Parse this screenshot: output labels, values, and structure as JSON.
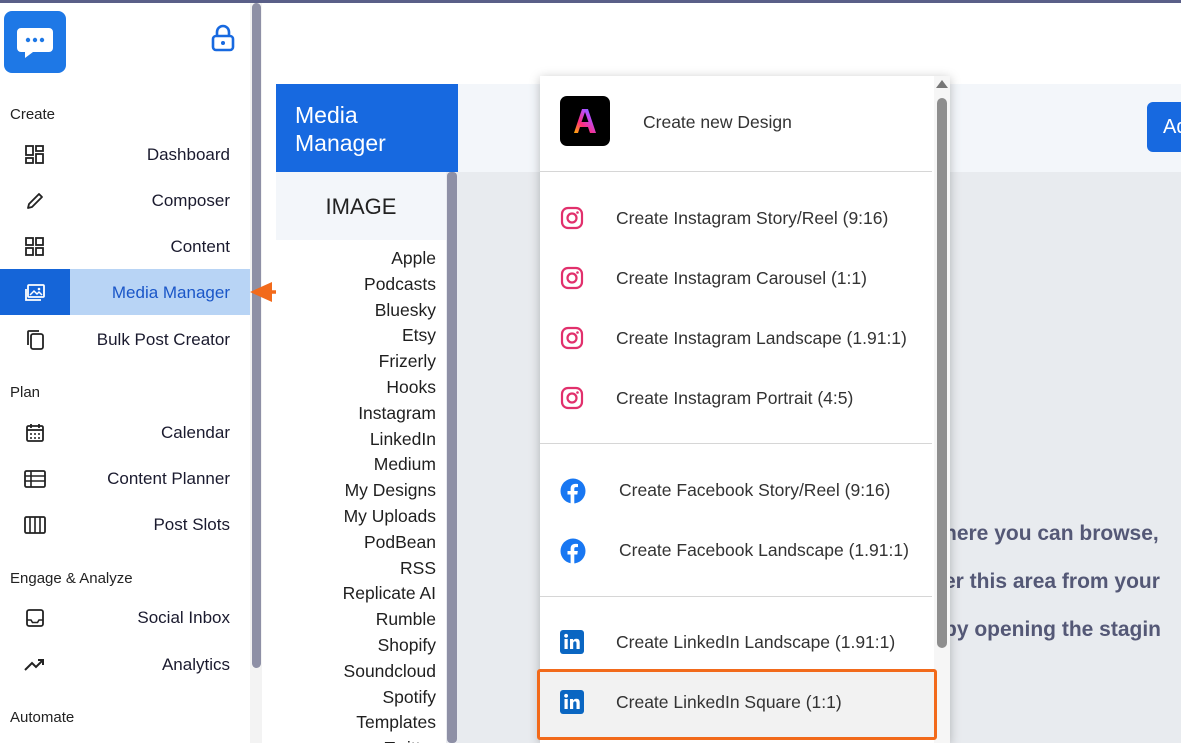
{
  "colors": {
    "accent": "#1769e0",
    "active_bg": "#b8d4f5",
    "highlight": "#f26a1b",
    "instagram": "#e1306c",
    "facebook": "#1877f2",
    "linkedin": "#0a66c2"
  },
  "sidebar": {
    "logo_icon": "chat-bubble-icon",
    "lock_icon": "lock-icon",
    "sections": {
      "create": "Create",
      "plan": "Plan",
      "engage": "Engage & Analyze",
      "automate": "Automate"
    },
    "items": [
      {
        "label": "Dashboard",
        "icon": "dashboard-icon"
      },
      {
        "label": "Composer",
        "icon": "pencil-icon"
      },
      {
        "label": "Content",
        "icon": "grid-icon"
      },
      {
        "label": "Media Manager",
        "icon": "image-gallery-icon",
        "active": true
      },
      {
        "label": "Bulk Post Creator",
        "icon": "copy-stack-icon"
      },
      {
        "label": "Calendar",
        "icon": "calendar-icon"
      },
      {
        "label": "Content Planner",
        "icon": "table-icon"
      },
      {
        "label": "Post Slots",
        "icon": "slots-icon"
      },
      {
        "label": "Social Inbox",
        "icon": "inbox-icon"
      },
      {
        "label": "Analytics",
        "icon": "trend-icon"
      }
    ]
  },
  "media_manager": {
    "title": "Media\nManager",
    "add_button": "Ad",
    "tab": "IMAGE",
    "sources": [
      "Apple",
      "Podcasts",
      "Bluesky",
      "Etsy",
      "Frizerly",
      "Hooks",
      "Instagram",
      "LinkedIn",
      "Medium",
      "My Designs",
      "My Uploads",
      "PodBean",
      "RSS",
      "Replicate AI",
      "Rumble",
      "Shopify",
      "Soundcloud",
      "Spotify",
      "Templates",
      "Twitter"
    ],
    "body_lines": [
      "here you can browse,",
      "er this area from your",
      "by opening the stagin"
    ]
  },
  "dropdown": {
    "items": [
      {
        "label": "Create new Design",
        "icon": "adobe-express-icon"
      },
      {
        "label": "Create Instagram Story/Reel (9:16)",
        "icon": "instagram-icon"
      },
      {
        "label": "Create Instagram Carousel (1:1)",
        "icon": "instagram-icon"
      },
      {
        "label": "Create Instagram Landscape (1.91:1)",
        "icon": "instagram-icon"
      },
      {
        "label": "Create Instagram Portrait (4:5)",
        "icon": "instagram-icon"
      },
      {
        "label": "Create Facebook Story/Reel (9:16)",
        "icon": "facebook-icon"
      },
      {
        "label": "Create Facebook Landscape (1.91:1)",
        "icon": "facebook-icon"
      },
      {
        "label": "Create LinkedIn Landscape (1.91:1)",
        "icon": "linkedin-icon"
      },
      {
        "label": "Create LinkedIn Square (1:1)",
        "icon": "linkedin-icon",
        "highlighted": true
      }
    ]
  }
}
